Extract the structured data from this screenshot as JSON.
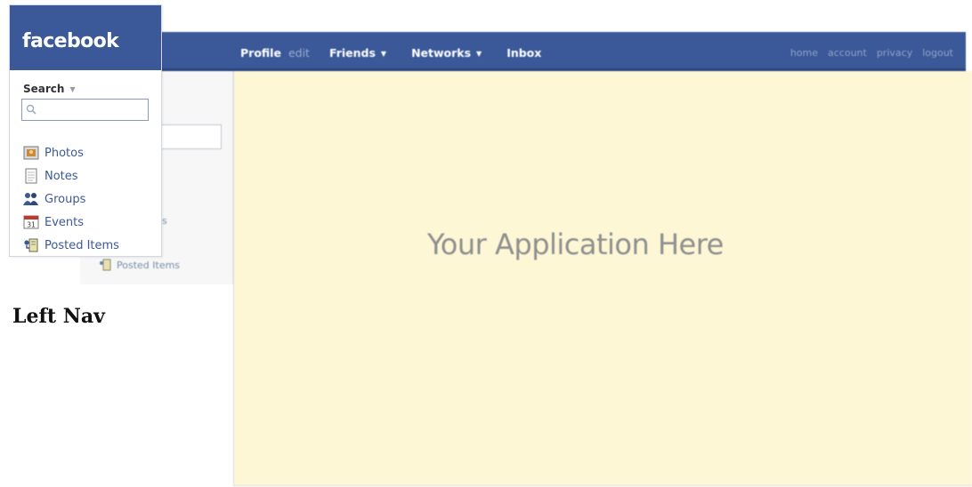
{
  "background": {
    "logo_fragment": "ook",
    "topnav": {
      "profile": "Profile",
      "edit": "edit",
      "friends": "Friends",
      "networks": "Networks",
      "inbox": "Inbox"
    },
    "rightnav": [
      "home",
      "account",
      "privacy",
      "logout"
    ],
    "sidebar_fragment": "s",
    "posted_items": "Posted Items"
  },
  "app": {
    "placeholder": "Your Application Here"
  },
  "left_nav": {
    "logo": "facebook",
    "search_label": "Search",
    "search_value": "",
    "items": [
      {
        "label": "Photos",
        "icon": "photos-icon"
      },
      {
        "label": "Notes",
        "icon": "notes-icon"
      },
      {
        "label": "Groups",
        "icon": "groups-icon"
      },
      {
        "label": "Events",
        "icon": "events-icon",
        "icon_text": "31"
      },
      {
        "label": "Posted Items",
        "icon": "posted-items-icon"
      }
    ]
  },
  "caption": "Left Nav",
  "colors": {
    "brand_blue": "#3b5998",
    "app_background": "#fdf7d6",
    "link_text": "#3b5998"
  }
}
